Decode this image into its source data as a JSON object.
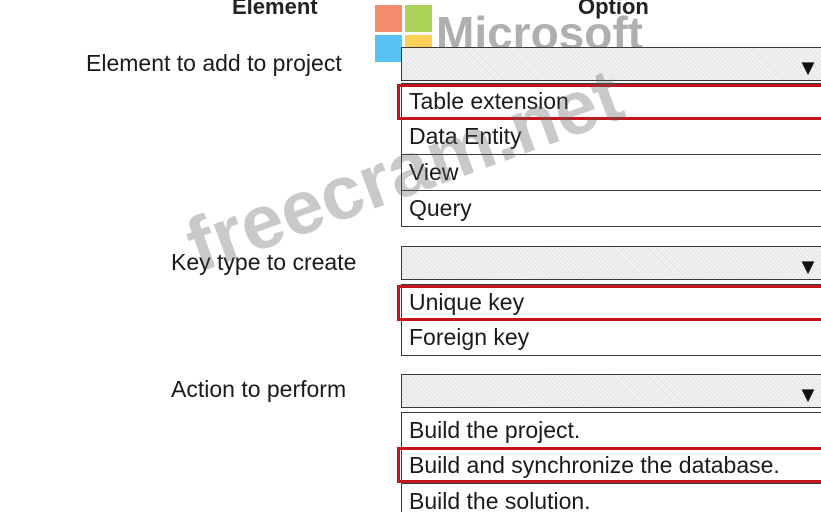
{
  "headers": {
    "element": "Element",
    "option": "Option"
  },
  "watermarks": {
    "brand_logo_text": "Microsoft",
    "site_text": "freecram.net"
  },
  "colors": {
    "selection_outline": "#c4151c",
    "ms_red": "#f25022",
    "ms_green": "#7fba00",
    "ms_blue": "#00a4ef",
    "ms_yellow": "#ffb900"
  },
  "rows": [
    {
      "label": "Element to add to project",
      "selected_index": 0,
      "options": [
        "Table extension",
        "Data Entity",
        "View",
        "Query"
      ]
    },
    {
      "label": "Key type to create",
      "selected_index": 0,
      "options": [
        "Unique key",
        "Foreign key"
      ]
    },
    {
      "label": "Action to perform",
      "selected_index": 1,
      "options": [
        "Build the project.",
        "Build and synchronize the database.",
        "Build the solution."
      ]
    }
  ],
  "icons": {
    "dropdown_arrow": "triangle-down-icon"
  }
}
